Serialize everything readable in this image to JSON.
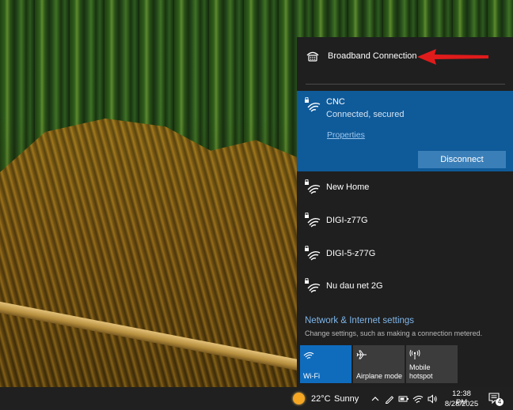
{
  "broadband": {
    "label": "Broadband Connection",
    "icon": "dialup-icon",
    "arrow_color": "#e01b1b"
  },
  "active_network": {
    "name": "CNC",
    "status": "Connected, secured",
    "properties_label": "Properties",
    "disconnect_label": "Disconnect",
    "icon": "wifi-secured-icon"
  },
  "networks": [
    {
      "name": "New Home",
      "icon": "wifi-secured-icon"
    },
    {
      "name": "DIGI-z77G",
      "icon": "wifi-secured-icon"
    },
    {
      "name": "DIGI-5-z77G",
      "icon": "wifi-secured-icon"
    },
    {
      "name": "Nu dau net 2G",
      "icon": "wifi-secured-icon"
    }
  ],
  "settings": {
    "link": "Network & Internet settings",
    "description": "Change settings, such as making a connection metered."
  },
  "quick_actions": [
    {
      "label": "Wi-Fi",
      "active": true,
      "icon": "wifi-icon"
    },
    {
      "label": "Airplane mode",
      "active": false,
      "icon": "airplane-icon"
    },
    {
      "label": "Mobile hotspot",
      "line1": "Mobile",
      "line2": "hotspot",
      "active": false,
      "icon": "hotspot-icon"
    }
  ],
  "taskbar": {
    "weather_temp": "22°C",
    "weather_condition": "Sunny",
    "time": "12:38 PM",
    "date": "8/28/2025",
    "notification_count": "4"
  },
  "colors": {
    "panel_bg": "#1f1f1f",
    "active_bg": "#0f5a99",
    "accent": "#0f6cbd",
    "link": "#7fb6ea"
  }
}
